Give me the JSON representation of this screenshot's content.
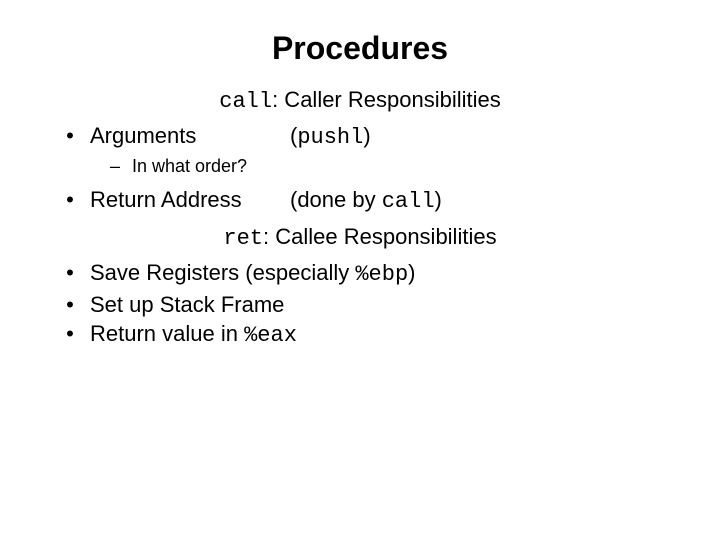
{
  "title": "Procedures",
  "caller_head_pre": "call",
  "caller_head_post": ": Caller Responsibilities",
  "b1_left": "Arguments",
  "b1_right_pre": "(",
  "b1_right_code": "pushl",
  "b1_right_post": ")",
  "sub_dash": "–",
  "sub_text": "In what order?",
  "b2_left": "Return Address",
  "b2_right_pre": "(done by ",
  "b2_right_code": "call",
  "b2_right_post": ")",
  "callee_head_pre": "ret",
  "callee_head_post": ": Callee Responsibilities",
  "b3_pre": "Save Registers (especially ",
  "b3_code": "%ebp",
  "b3_post": ")",
  "b4": "Set up Stack Frame",
  "b5_pre": "Return value in ",
  "b5_code": "%eax",
  "bullet": "•"
}
